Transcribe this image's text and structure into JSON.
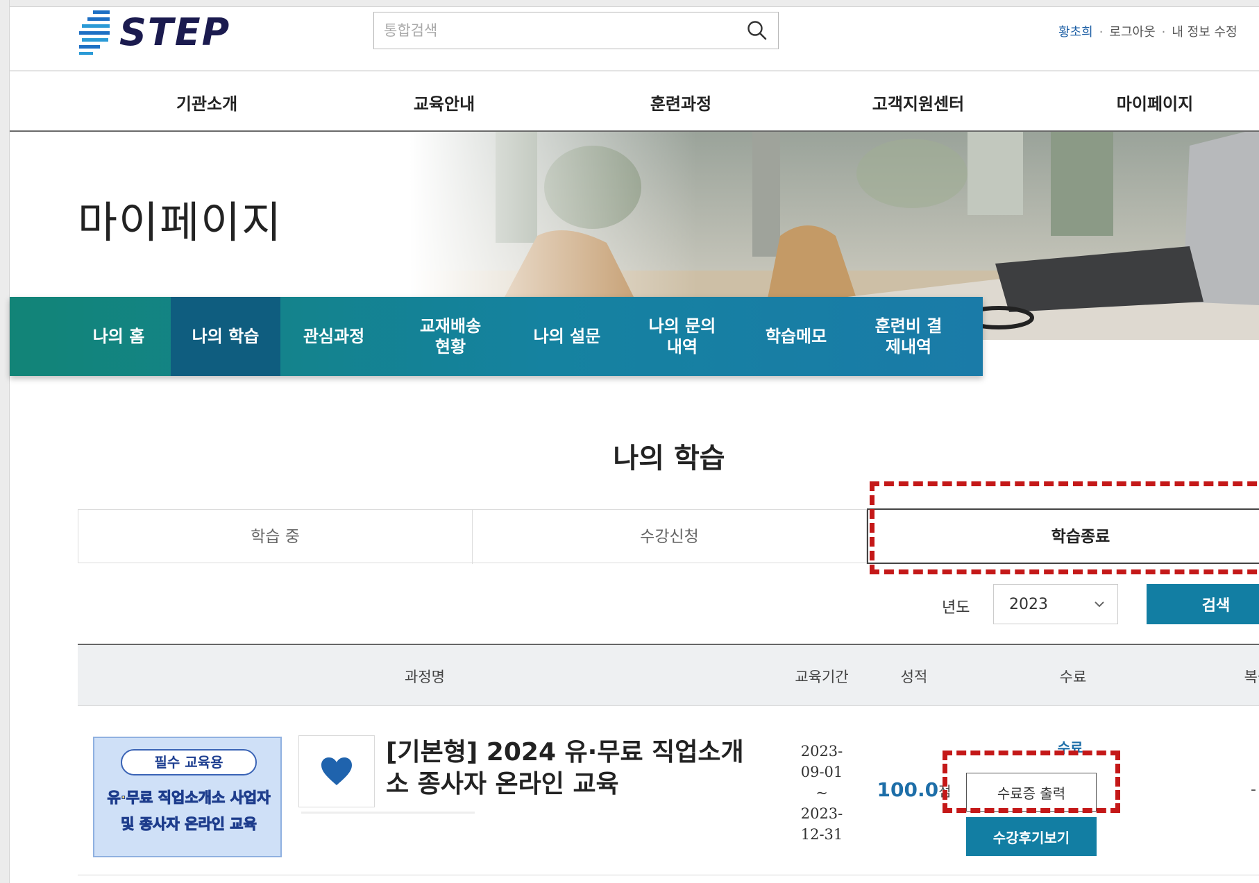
{
  "header": {
    "brand": "STEP",
    "search": {
      "placeholder": "통합검색",
      "value": ""
    },
    "user": {
      "name": "황초희",
      "sep": "·",
      "logout": "로그아웃",
      "edit_profile": "내 정보 수정"
    }
  },
  "gnb": [
    "기관소개",
    "교육안내",
    "훈련과정",
    "고객지원센터",
    "마이페이지"
  ],
  "banner": {
    "title": "마이페이지"
  },
  "lnb": [
    {
      "label": "나의 홈"
    },
    {
      "label": "나의 학습",
      "active": true
    },
    {
      "label": "관심과정"
    },
    {
      "label1": "교재배송",
      "label2": "현황"
    },
    {
      "label": "나의 설문"
    },
    {
      "label1": "나의 문의",
      "label2": "내역"
    },
    {
      "label": "학습메모"
    },
    {
      "label1": "훈련비 결",
      "label2": "제내역"
    }
  ],
  "section": {
    "title": "나의 학습"
  },
  "tabs": [
    {
      "label": "학습 중"
    },
    {
      "label": "수강신청"
    },
    {
      "label": "학습종료",
      "active": true
    }
  ],
  "filter": {
    "year_label": "년도",
    "year_value": "2023",
    "search_label": "검색"
  },
  "table": {
    "headers": [
      "과정명",
      "교육기간",
      "성적",
      "수료",
      "복습"
    ],
    "rows": [
      {
        "thumb": {
          "badge": "필수 교육용",
          "line1_hl": "유·무료",
          "line1": " 직업소개소 사업자",
          "line2": "및 종사자 온라인 교육"
        },
        "title": "[기본형] 2024 유·무료 직업소개소 종사자 온라인 교육",
        "period_start": "2023-\n09-01",
        "period_sep": "~",
        "period_end": "2023-\n12-31",
        "score": "100.0",
        "score_unit": "점",
        "complete": "수료",
        "cert_button": "수료증 출력",
        "review_button": "수강후기보기",
        "replay": "-"
      }
    ]
  },
  "colors": {
    "accent": "#127ea3",
    "lnb_active": "#0f5d7f",
    "highlight_dash": "#c41818",
    "score": "#1d6ea8"
  }
}
